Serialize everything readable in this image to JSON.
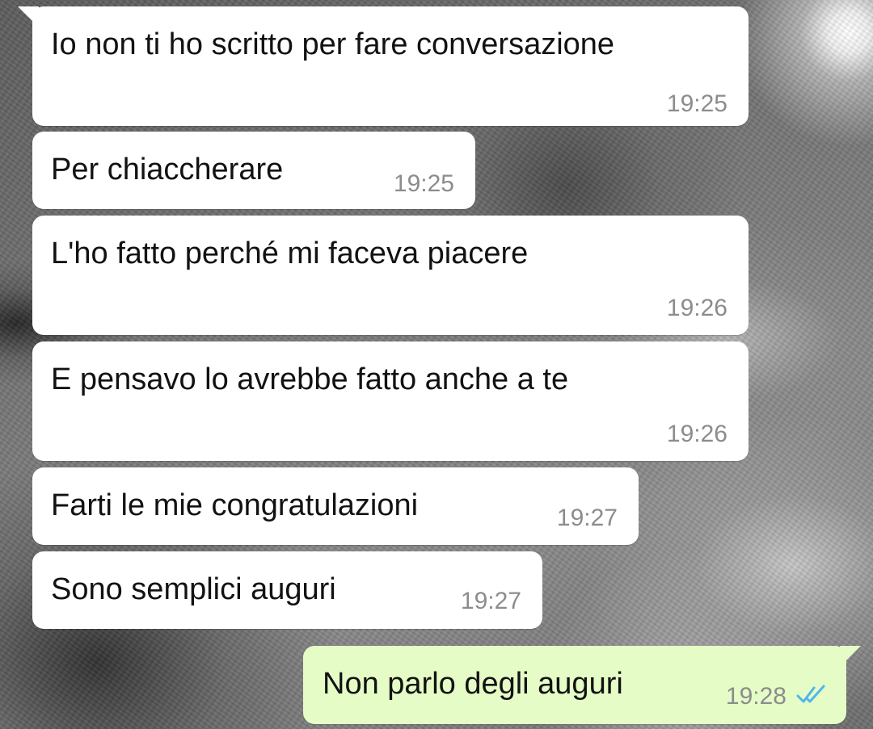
{
  "theme": {
    "incoming_bubble_color": "#ffffff",
    "outgoing_bubble_color": "#e5fcc6",
    "text_color": "#121212",
    "time_color": "#8c8c8c",
    "read_tick_color": "#4fb6ec"
  },
  "messages": [
    {
      "direction": "incoming",
      "text": "Io non ti ho scritto per fare conversazione",
      "time": "19:25"
    },
    {
      "direction": "incoming",
      "text": "Per chiaccherare",
      "time": "19:25"
    },
    {
      "direction": "incoming",
      "text": "L'ho fatto perché mi faceva piacere",
      "time": "19:26"
    },
    {
      "direction": "incoming",
      "text": "E pensavo lo avrebbe fatto anche a te",
      "time": "19:26"
    },
    {
      "direction": "incoming",
      "text": "Farti le mie congratulazioni",
      "time": "19:27"
    },
    {
      "direction": "incoming",
      "text": "Sono semplici auguri",
      "time": "19:27"
    },
    {
      "direction": "outgoing",
      "text": "Non parlo degli auguri",
      "time": "19:28",
      "status_icon": "double-check-read-icon"
    }
  ]
}
